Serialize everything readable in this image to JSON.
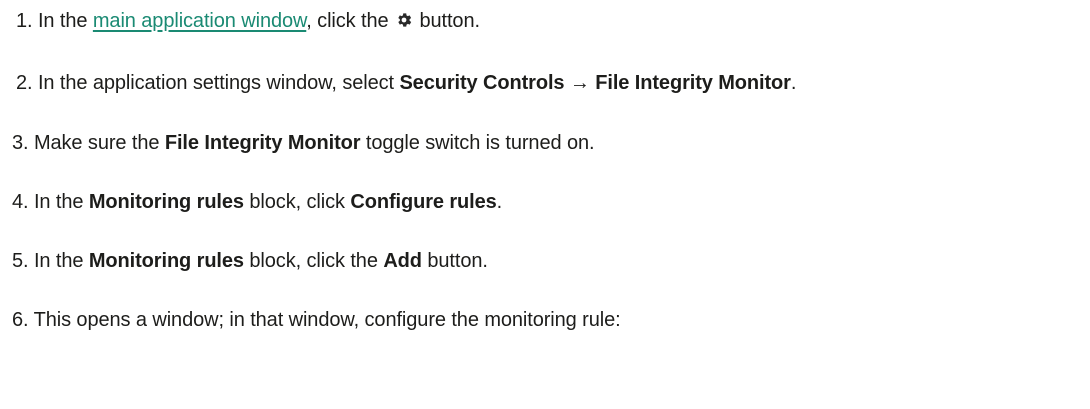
{
  "steps": [
    {
      "num": "1.",
      "t1": "In the",
      "link": "main application window",
      "t2": ", click the",
      "icon": "gear-icon",
      "t3": "button."
    },
    {
      "num": "2.",
      "t1": "In the application settings window, select",
      "b1": "Security Controls",
      "arrow": "→",
      "b2": "File Integrity Monitor",
      "t2": "."
    },
    {
      "num": "3.",
      "t1": "Make sure the",
      "b1": "File Integrity Monitor",
      "t2": "toggle switch is turned on."
    },
    {
      "num": "4.",
      "t1": "In the",
      "b1": "Monitoring rules",
      "t2": "block, click",
      "b2": "Configure rules",
      "t3": "."
    },
    {
      "num": "5.",
      "t1": "In the",
      "b1": "Monitoring rules",
      "t2": "block, click the",
      "b2": "Add",
      "t3": "button."
    },
    {
      "num": "6.",
      "t1": "This opens a window; in that window, configure the monitoring rule:"
    }
  ],
  "colors": {
    "text": "#1d1d1b",
    "link": "#1a8a73"
  }
}
